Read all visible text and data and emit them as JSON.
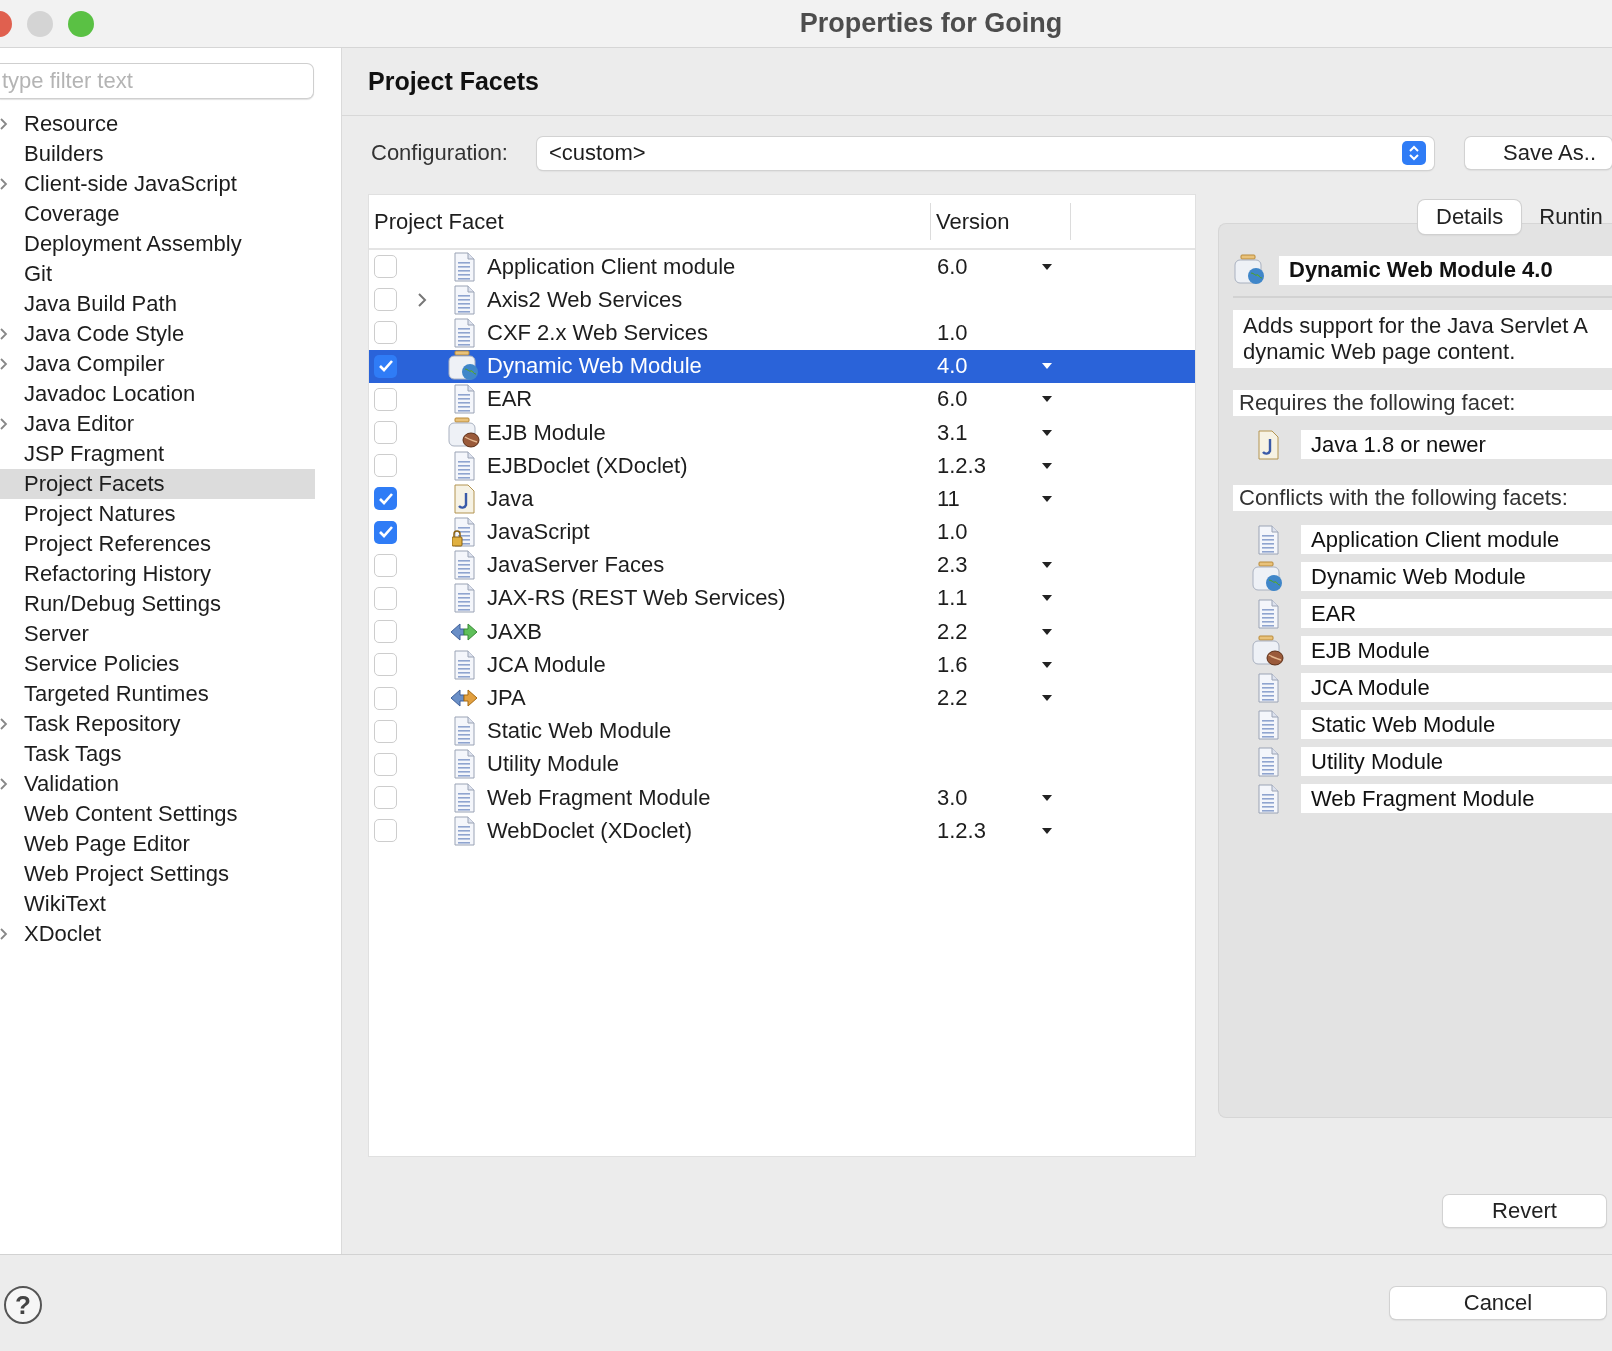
{
  "window": {
    "title": "Properties for Going"
  },
  "sidebar": {
    "filter": {
      "placeholder": "type filter text"
    },
    "items": [
      {
        "label": "Resource",
        "expandable": true,
        "selected": false
      },
      {
        "label": "Builders",
        "expandable": false,
        "selected": false
      },
      {
        "label": "Client-side JavaScript",
        "expandable": true,
        "selected": false
      },
      {
        "label": "Coverage",
        "expandable": false,
        "selected": false
      },
      {
        "label": "Deployment Assembly",
        "expandable": false,
        "selected": false
      },
      {
        "label": "Git",
        "expandable": false,
        "selected": false
      },
      {
        "label": "Java Build Path",
        "expandable": false,
        "selected": false
      },
      {
        "label": "Java Code Style",
        "expandable": true,
        "selected": false
      },
      {
        "label": "Java Compiler",
        "expandable": true,
        "selected": false
      },
      {
        "label": "Javadoc Location",
        "expandable": false,
        "selected": false
      },
      {
        "label": "Java Editor",
        "expandable": true,
        "selected": false
      },
      {
        "label": "JSP Fragment",
        "expandable": false,
        "selected": false
      },
      {
        "label": "Project Facets",
        "expandable": false,
        "selected": true
      },
      {
        "label": "Project Natures",
        "expandable": false,
        "selected": false
      },
      {
        "label": "Project References",
        "expandable": false,
        "selected": false
      },
      {
        "label": "Refactoring History",
        "expandable": false,
        "selected": false
      },
      {
        "label": "Run/Debug Settings",
        "expandable": false,
        "selected": false
      },
      {
        "label": "Server",
        "expandable": false,
        "selected": false
      },
      {
        "label": "Service Policies",
        "expandable": false,
        "selected": false
      },
      {
        "label": "Targeted Runtimes",
        "expandable": false,
        "selected": false
      },
      {
        "label": "Task Repository",
        "expandable": true,
        "selected": false
      },
      {
        "label": "Task Tags",
        "expandable": false,
        "selected": false
      },
      {
        "label": "Validation",
        "expandable": true,
        "selected": false
      },
      {
        "label": "Web Content Settings",
        "expandable": false,
        "selected": false
      },
      {
        "label": "Web Page Editor",
        "expandable": false,
        "selected": false
      },
      {
        "label": "Web Project Settings",
        "expandable": false,
        "selected": false
      },
      {
        "label": "WikiText",
        "expandable": false,
        "selected": false
      },
      {
        "label": "XDoclet",
        "expandable": true,
        "selected": false
      }
    ]
  },
  "page": {
    "title": "Project Facets",
    "configuration": {
      "label": "Configuration:",
      "value": "<custom>"
    },
    "save_button": "Save As..",
    "revert_button": "Revert"
  },
  "table": {
    "columns": [
      "Project Facet",
      "Version"
    ],
    "rows": [
      {
        "name": "Application Client module",
        "version": "6.0",
        "kind": "document",
        "checked": false,
        "expandable": false,
        "dropdown": true,
        "selected": false
      },
      {
        "name": "Axis2 Web Services",
        "kind": "document",
        "checked": false,
        "expandable": true,
        "dropdown": false,
        "selected": false
      },
      {
        "name": "CXF 2.x Web Services",
        "version": "1.0",
        "kind": "document",
        "checked": false,
        "expandable": false,
        "dropdown": false,
        "selected": false
      },
      {
        "name": "Dynamic Web Module",
        "version": "4.0",
        "kind": "web",
        "checked": true,
        "expandable": false,
        "dropdown": true,
        "selected": true
      },
      {
        "name": "EAR",
        "version": "6.0",
        "kind": "document",
        "checked": false,
        "expandable": false,
        "dropdown": true,
        "selected": false
      },
      {
        "name": "EJB Module",
        "version": "3.1",
        "kind": "ejb",
        "checked": false,
        "expandable": false,
        "dropdown": true,
        "selected": false
      },
      {
        "name": "EJBDoclet (XDoclet)",
        "version": "1.2.3",
        "kind": "document",
        "checked": false,
        "expandable": false,
        "dropdown": true,
        "selected": false
      },
      {
        "name": "Java",
        "version": "11",
        "kind": "java",
        "checked": true,
        "expandable": false,
        "dropdown": true,
        "selected": false
      },
      {
        "name": "JavaScript",
        "version": "1.0",
        "kind": "locked",
        "checked": true,
        "expandable": false,
        "dropdown": false,
        "selected": false
      },
      {
        "name": "JavaServer Faces",
        "version": "2.3",
        "kind": "document",
        "checked": false,
        "expandable": false,
        "dropdown": true,
        "selected": false
      },
      {
        "name": "JAX-RS (REST Web Services)",
        "version": "1.1",
        "kind": "document",
        "checked": false,
        "expandable": false,
        "dropdown": true,
        "selected": false
      },
      {
        "name": "JAXB",
        "version": "2.2",
        "kind": "binding",
        "checked": false,
        "expandable": false,
        "dropdown": true,
        "selected": false
      },
      {
        "name": "JCA Module",
        "version": "1.6",
        "kind": "document",
        "checked": false,
        "expandable": false,
        "dropdown": true,
        "selected": false
      },
      {
        "name": "JPA",
        "version": "2.2",
        "kind": "persistence",
        "checked": false,
        "expandable": false,
        "dropdown": true,
        "selected": false
      },
      {
        "name": "Static Web Module",
        "kind": "document",
        "checked": false,
        "expandable": false,
        "dropdown": false,
        "selected": false
      },
      {
        "name": "Utility Module",
        "kind": "document",
        "checked": false,
        "expandable": false,
        "dropdown": false,
        "selected": false
      },
      {
        "name": "Web Fragment Module",
        "version": "3.0",
        "kind": "document",
        "checked": false,
        "expandable": false,
        "dropdown": true,
        "selected": false
      },
      {
        "name": "WebDoclet (XDoclet)",
        "version": "1.2.3",
        "kind": "document",
        "checked": false,
        "expandable": false,
        "dropdown": true,
        "selected": false
      }
    ]
  },
  "details": {
    "tabs": [
      {
        "label": "Details",
        "selected": true
      },
      {
        "label": "Runtin",
        "selected": false
      }
    ],
    "title": {
      "text": "Dynamic Web Module 4.0",
      "kind": "web"
    },
    "description": [
      "Adds support for the Java Servlet A",
      "dynamic Web page content."
    ],
    "requires_label": "Requires the following facet:",
    "requires": [
      {
        "text": "Java 1.8 or newer",
        "kind": "java"
      }
    ],
    "conflicts_label": "Conflicts with the following facets:",
    "conflicts": [
      {
        "text": "Application Client module",
        "kind": "document"
      },
      {
        "text": "Dynamic Web Module",
        "kind": "web"
      },
      {
        "text": "EAR",
        "kind": "document"
      },
      {
        "text": "EJB Module",
        "kind": "ejb"
      },
      {
        "text": "JCA Module",
        "kind": "document"
      },
      {
        "text": "Static Web Module",
        "kind": "document"
      },
      {
        "text": "Utility Module",
        "kind": "document"
      },
      {
        "text": "Web Fragment Module",
        "kind": "document"
      }
    ]
  },
  "footer": {
    "help": "?",
    "cancel_button": "Cancel"
  }
}
